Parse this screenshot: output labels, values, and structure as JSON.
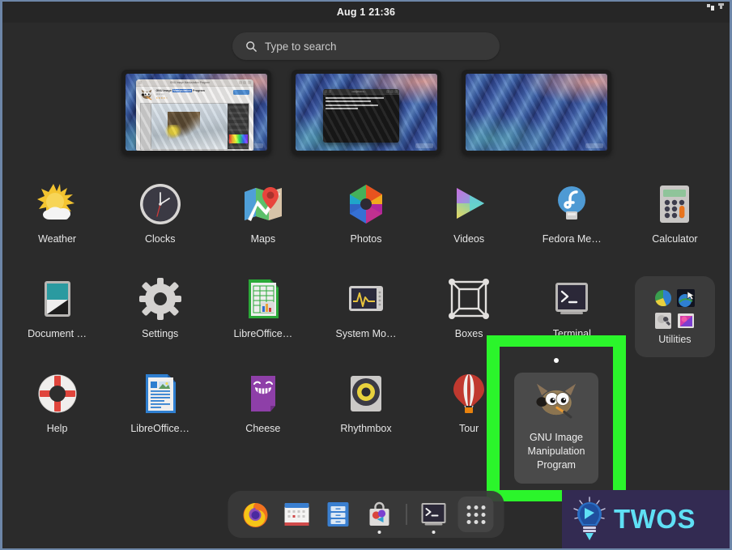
{
  "panel": {
    "clock": "Aug 1  21:36",
    "indicators": [
      "network-icon",
      "system-menu-icon"
    ]
  },
  "search": {
    "placeholder": "Type to search",
    "icon": "search-icon",
    "value": ""
  },
  "workspaces": [
    {
      "name": "workspace-1",
      "window": "GNU Image Manipulation Program - Software",
      "window_type": "gnome-software",
      "software": {
        "title_prefix": "GNU Image ",
        "title_highlight": "Manipulation",
        "title_suffix": " Program",
        "subtitle": "gimp.org",
        "stars": "★★★★☆",
        "rating_count": "(864)",
        "header_title": "GNU Image Manipulation Program",
        "install_label": "Installed"
      }
    },
    {
      "name": "workspace-2",
      "window": "Terminal",
      "window_type": "terminal",
      "terminal": {
        "title": "user@fedora:~"
      }
    },
    {
      "name": "workspace-3",
      "window": "",
      "window_type": "empty"
    }
  ],
  "apps": [
    {
      "label": "Weather",
      "icon": "weather-icon",
      "name": "app-weather"
    },
    {
      "label": "Clocks",
      "icon": "clocks-icon",
      "name": "app-clocks"
    },
    {
      "label": "Maps",
      "icon": "maps-icon",
      "name": "app-maps"
    },
    {
      "label": "Photos",
      "icon": "photos-icon",
      "name": "app-photos"
    },
    {
      "label": "Videos",
      "icon": "videos-icon",
      "name": "app-videos"
    },
    {
      "label": "Fedora Me…",
      "icon": "fedora-media-writer-icon",
      "name": "app-fedora-media-writer"
    },
    {
      "label": "Calculator",
      "icon": "calculator-icon",
      "name": "app-calculator"
    },
    {
      "label": "Document …",
      "icon": "document-viewer-icon",
      "name": "app-document-viewer"
    },
    {
      "label": "Settings",
      "icon": "settings-gear-icon",
      "name": "app-settings"
    },
    {
      "label": "LibreOffice…",
      "icon": "libreoffice-calc-icon",
      "name": "app-libreoffice-calc"
    },
    {
      "label": "System Mo…",
      "icon": "system-monitor-icon",
      "name": "app-system-monitor"
    },
    {
      "label": "Boxes",
      "icon": "boxes-icon",
      "name": "app-boxes"
    },
    {
      "label": "Terminal",
      "icon": "terminal-icon",
      "name": "app-terminal"
    },
    {
      "label": "Help",
      "icon": "help-icon",
      "name": "app-help"
    },
    {
      "label": "LibreOffice…",
      "icon": "libreoffice-writer-icon",
      "name": "app-libreoffice-writer"
    },
    {
      "label": "Cheese",
      "icon": "cheese-icon",
      "name": "app-cheese"
    },
    {
      "label": "Rhythmbox",
      "icon": "rhythmbox-icon",
      "name": "app-rhythmbox"
    },
    {
      "label": "Tour",
      "icon": "tour-balloon-icon",
      "name": "app-tour"
    }
  ],
  "folder": {
    "label": "Utilities",
    "mini_icons": [
      "disk-usage-analyzer-icon",
      "screenshot-icon",
      "disks-icon",
      "image-viewer-icon"
    ]
  },
  "highlight": {
    "color": "#2bf52b",
    "target": "GNU Image Manipulation Program"
  },
  "gimp_card": {
    "icon": "gimp-wilber-icon",
    "line1": "GNU Image",
    "line2": "Manipulation",
    "line3": "Program"
  },
  "dock": [
    {
      "label": "Firefox",
      "icon": "firefox-icon",
      "name": "dock-firefox",
      "running": false
    },
    {
      "label": "Calendar",
      "icon": "calendar-icon",
      "name": "dock-calendar",
      "running": false
    },
    {
      "label": "Files",
      "icon": "files-icon",
      "name": "dock-files",
      "running": false
    },
    {
      "label": "Software",
      "icon": "software-bag-icon",
      "name": "dock-software",
      "running": true
    },
    {
      "label": "Terminal",
      "icon": "terminal-icon",
      "name": "dock-terminal",
      "running": true
    }
  ],
  "apps_button": {
    "label": "Show Applications",
    "icon": "grid-apps-icon"
  },
  "watermark": {
    "text": "TWOS",
    "icon": "lightbulb-logo-icon",
    "background": "#332b52",
    "text_color": "#5fe0f5"
  }
}
